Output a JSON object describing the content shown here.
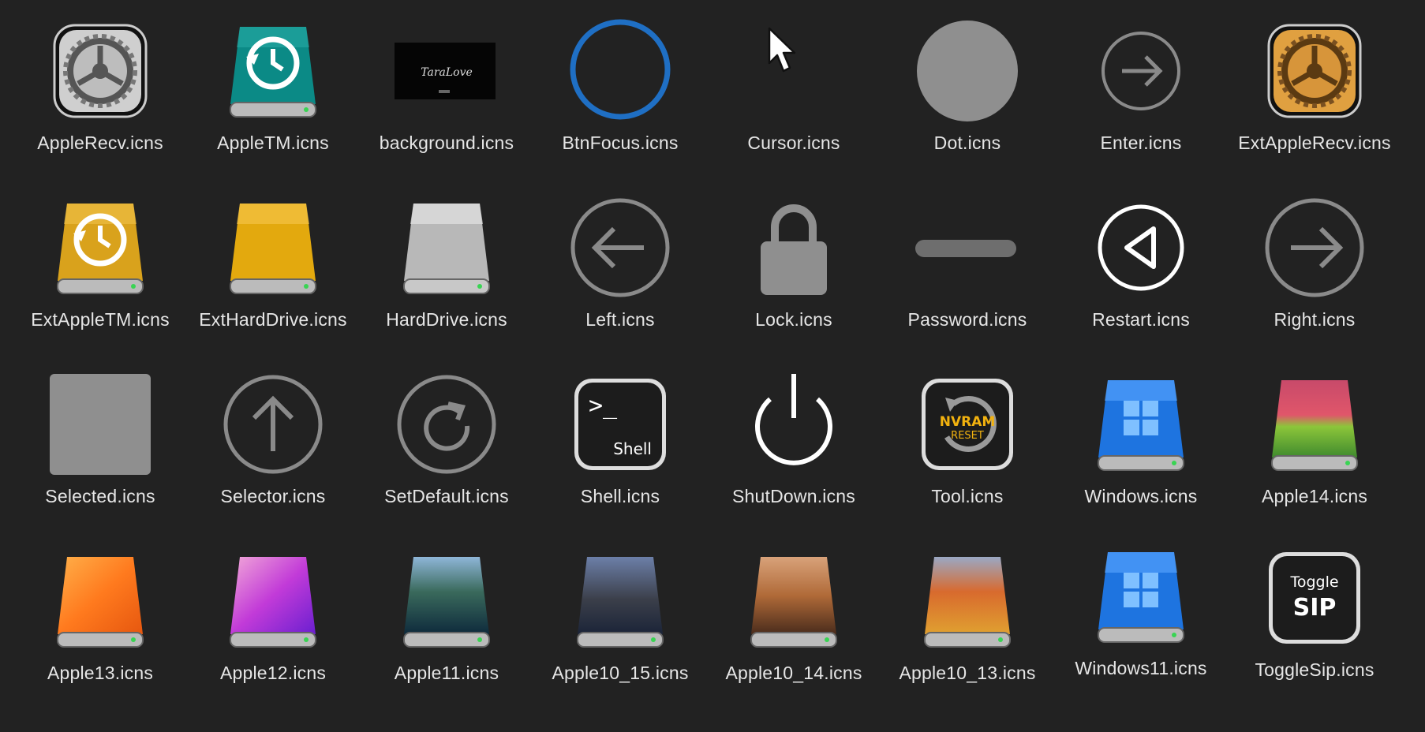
{
  "files": [
    {
      "name": "AppleRecv.icns",
      "icon": "gear-icon"
    },
    {
      "name": "AppleTM.icns",
      "icon": "time-machine-drive-icon"
    },
    {
      "name": "background.icns",
      "icon": "background-image-icon",
      "image_text": "TaraLove"
    },
    {
      "name": "BtnFocus.icns",
      "icon": "focus-ring-icon"
    },
    {
      "name": "Cursor.icns",
      "icon": "cursor-icon"
    },
    {
      "name": "Dot.icns",
      "icon": "dot-icon"
    },
    {
      "name": "Enter.icns",
      "icon": "enter-arrow-icon"
    },
    {
      "name": "ExtAppleRecv.icns",
      "icon": "gear-gold-icon"
    },
    {
      "name": "ExtAppleTM.icns",
      "icon": "time-machine-gold-drive-icon"
    },
    {
      "name": "ExtHardDrive.icns",
      "icon": "gold-drive-icon"
    },
    {
      "name": "HardDrive.icns",
      "icon": "silver-drive-icon"
    },
    {
      "name": "Left.icns",
      "icon": "left-arrow-icon"
    },
    {
      "name": "Lock.icns",
      "icon": "lock-icon"
    },
    {
      "name": "Password.icns",
      "icon": "password-bar-icon"
    },
    {
      "name": "Restart.icns",
      "icon": "restart-icon"
    },
    {
      "name": "Right.icns",
      "icon": "right-arrow-icon"
    },
    {
      "name": "Selected.icns",
      "icon": "selected-square-icon"
    },
    {
      "name": "Selector.icns",
      "icon": "up-arrow-icon"
    },
    {
      "name": "SetDefault.icns",
      "icon": "refresh-icon"
    },
    {
      "name": "Shell.icns",
      "icon": "terminal-icon",
      "prompt": ">_",
      "caption": "Shell"
    },
    {
      "name": "ShutDown.icns",
      "icon": "power-icon"
    },
    {
      "name": "Tool.icns",
      "icon": "nvram-reset-icon",
      "line1": "NVRAM",
      "line2": "RESET"
    },
    {
      "name": "Windows.icns",
      "icon": "windows-drive-icon"
    },
    {
      "name": "Apple14.icns",
      "icon": "sonoma-drive-icon"
    },
    {
      "name": "Apple13.icns",
      "icon": "ventura-drive-icon"
    },
    {
      "name": "Apple12.icns",
      "icon": "monterey-drive-icon"
    },
    {
      "name": "Apple11.icns",
      "icon": "bigsur-drive-icon"
    },
    {
      "name": "Apple10_15.icns",
      "icon": "catalina-drive-icon"
    },
    {
      "name": "Apple10_14.icns",
      "icon": "mojave-drive-icon"
    },
    {
      "name": "Apple10_13.icns",
      "icon": "highsierra-drive-icon"
    },
    {
      "name": "Windows11.icns",
      "icon": "windows11-drive-icon"
    },
    {
      "name": "ToggleSip.icns",
      "icon": "toggle-sip-icon",
      "line1": "Toggle",
      "line2": "SIP"
    }
  ]
}
